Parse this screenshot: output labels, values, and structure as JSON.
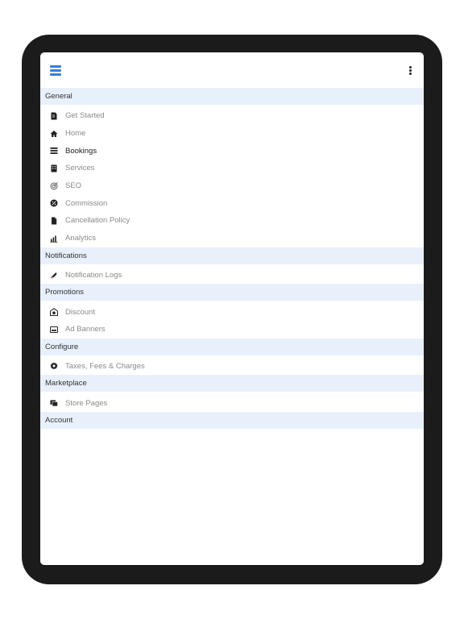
{
  "sections": [
    {
      "title": "General",
      "items": [
        {
          "label": "Get Started",
          "icon": "document-edit-icon"
        },
        {
          "label": "Home",
          "icon": "home-icon"
        },
        {
          "label": "Bookings",
          "icon": "list-icon",
          "active": true
        },
        {
          "label": "Services",
          "icon": "building-icon"
        },
        {
          "label": "SEO",
          "icon": "target-icon"
        },
        {
          "label": "Commission",
          "icon": "percent-icon"
        },
        {
          "label": "Cancellation Policy",
          "icon": "file-icon"
        },
        {
          "label": "Analytics",
          "icon": "bar-chart-icon"
        }
      ]
    },
    {
      "title": "Notifications",
      "items": [
        {
          "label": "Notification Logs",
          "icon": "bell-icon"
        }
      ]
    },
    {
      "title": "Promotions",
      "items": [
        {
          "label": "Discount",
          "icon": "store-discount-icon"
        },
        {
          "label": "Ad Banners",
          "icon": "banner-icon"
        }
      ]
    },
    {
      "title": "Configure",
      "items": [
        {
          "label": "Taxes, Fees & Charges",
          "icon": "gear-icon"
        }
      ]
    },
    {
      "title": "Marketplace",
      "items": [
        {
          "label": "Store Pages",
          "icon": "copy-icon"
        }
      ]
    },
    {
      "title": "Account",
      "items": []
    }
  ],
  "colors": {
    "accent": "#3b7fd1",
    "section_bg": "#e8f1fb",
    "muted_text": "#8a8a8a",
    "active_text": "#222222"
  }
}
